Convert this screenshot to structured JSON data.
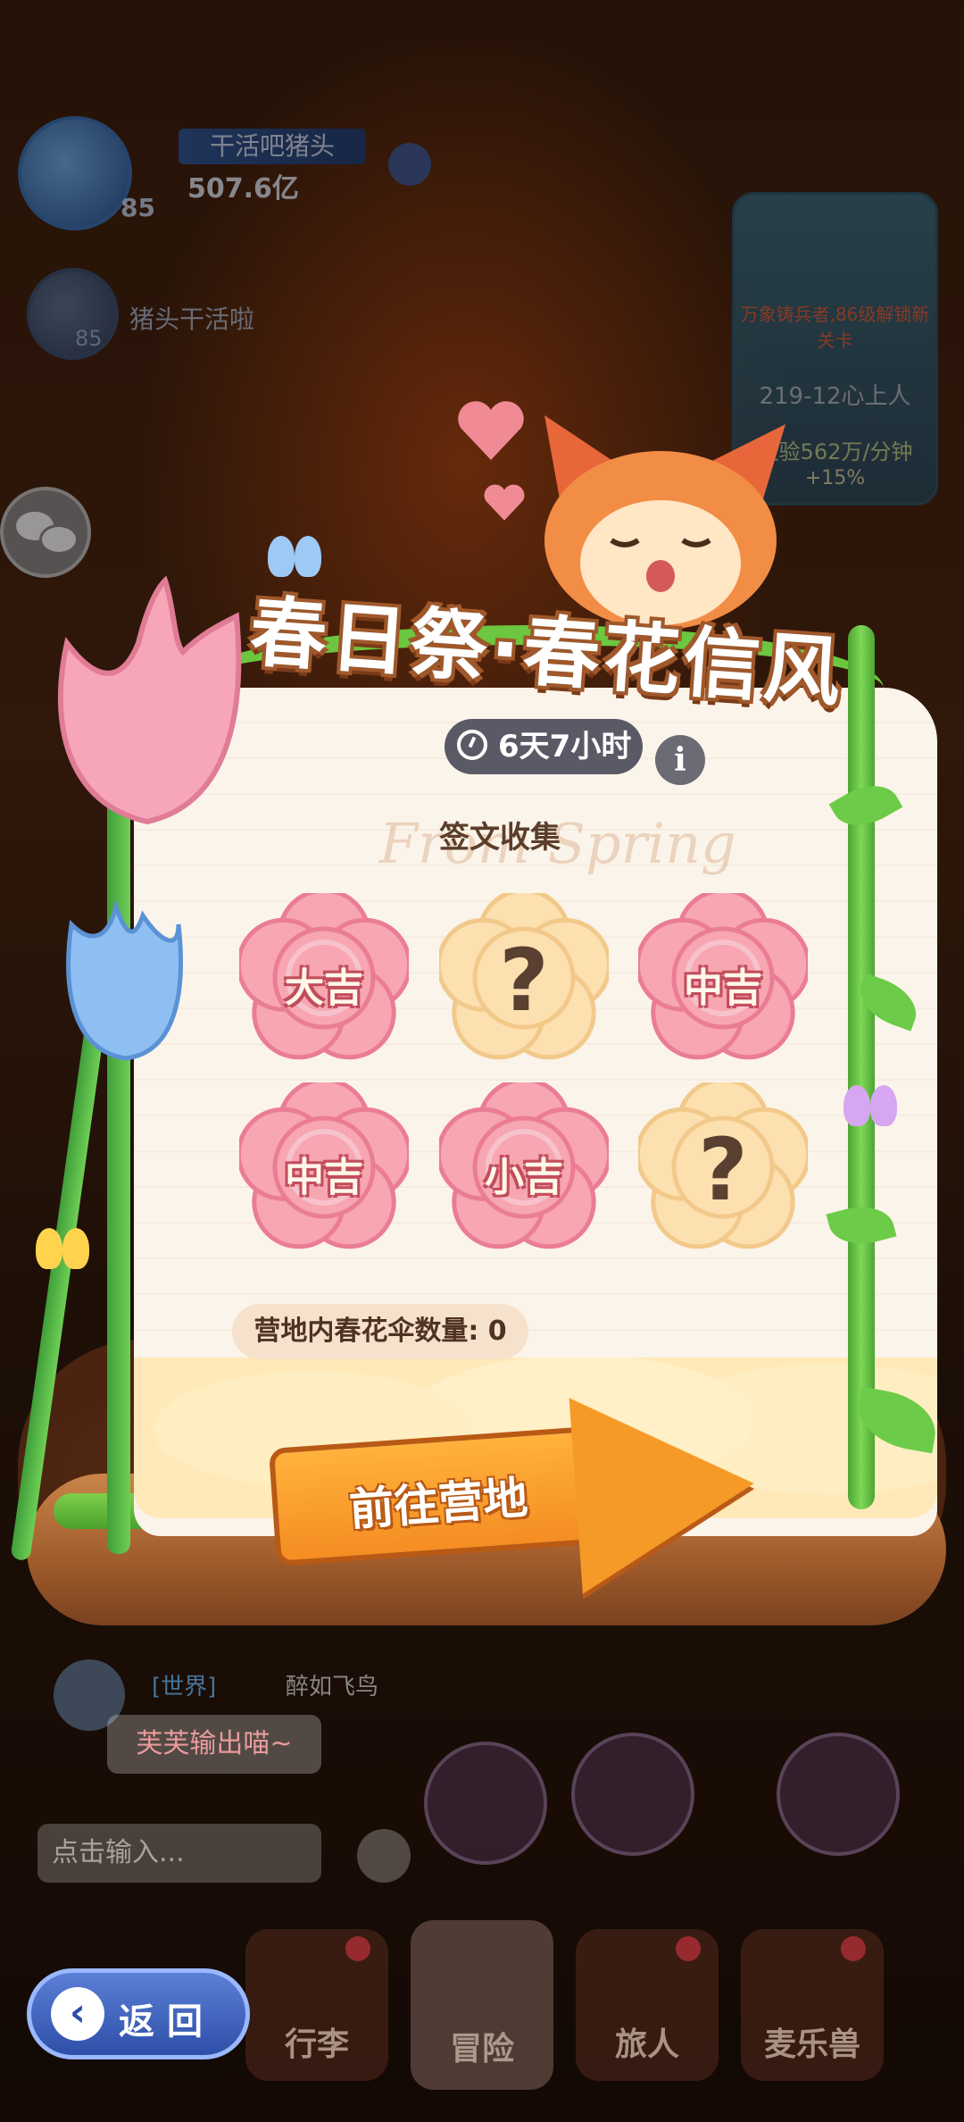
{
  "hud": {
    "player_name": "干活吧猪头",
    "player_power": "507.6亿",
    "player_level": "85",
    "player2_name": "猪头干活啦",
    "player2_level": "85"
  },
  "stage": {
    "note": "万象铸兵者,86级解锁新关卡",
    "name": "219-12心上人",
    "exp": "经验562万/分钟",
    "bonus": "+15%"
  },
  "event": {
    "title": "春日祭·春花信风",
    "timer": "6天7小时",
    "info_label": "i",
    "watermark": "From Spring",
    "section_title": "签文收集",
    "fortunes": [
      "大吉",
      "?",
      "中吉",
      "中吉",
      "小吉",
      "?"
    ],
    "umbrella_count_label": "营地内春花伞数量: 0",
    "cta_label": "前往营地"
  },
  "chat": {
    "tag": "[世界]",
    "user": "醉如飞鸟",
    "message": "芙芙输出喵~",
    "input_placeholder": "点击输入..."
  },
  "tabs": [
    "行李",
    "冒险",
    "旅人",
    "麦乐兽"
  ],
  "back": {
    "label": "返回"
  },
  "colors": {
    "petal_pink": "#f7a6b2",
    "petal_unknown": "#fde0b0",
    "cta_orange": "#f59a26",
    "back_blue": "#3d5fbe"
  }
}
